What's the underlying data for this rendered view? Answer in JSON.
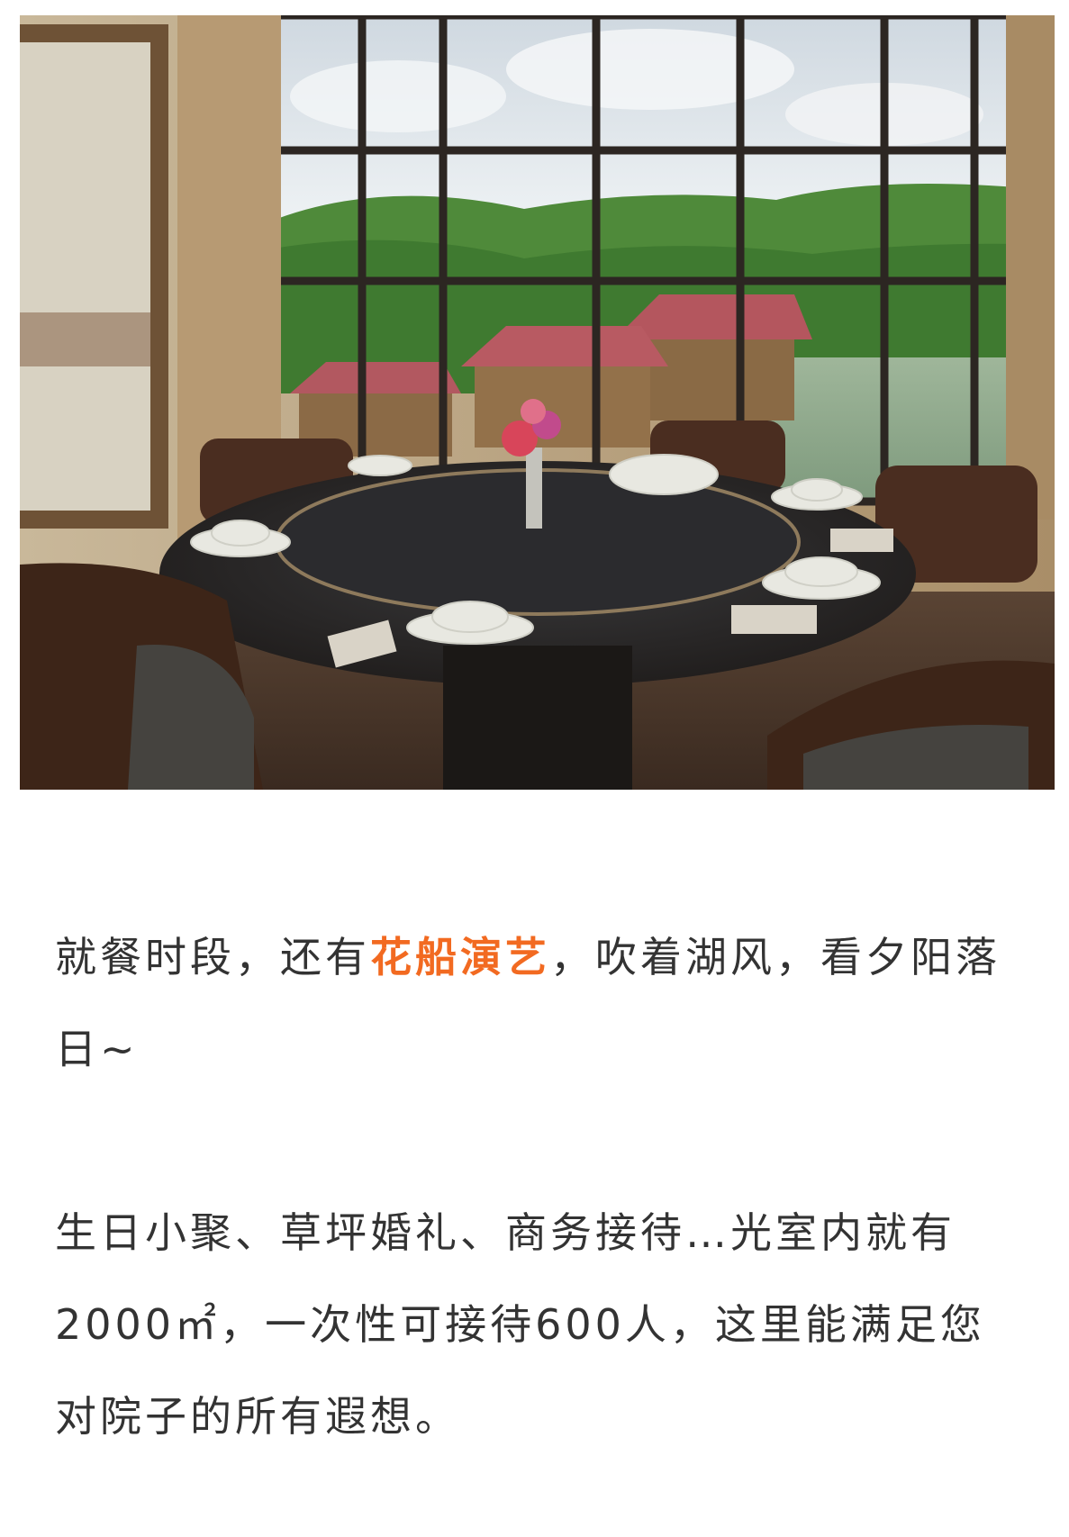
{
  "photo": {
    "subject": "restaurant-dining-room-lake-view"
  },
  "article": {
    "paragraph1": {
      "before": "就餐时段，还有",
      "highlight": "花船演艺",
      "after": "，吹着湖风，看夕阳落日~"
    },
    "paragraph2": "生日小聚、草坪婚礼、商务接待…光室内就有2000㎡，一次性可接待600人，这里能满足您对院子的所有遐想。"
  },
  "colors": {
    "text": "#333333",
    "highlight": "#f26a21",
    "background": "#ffffff"
  }
}
